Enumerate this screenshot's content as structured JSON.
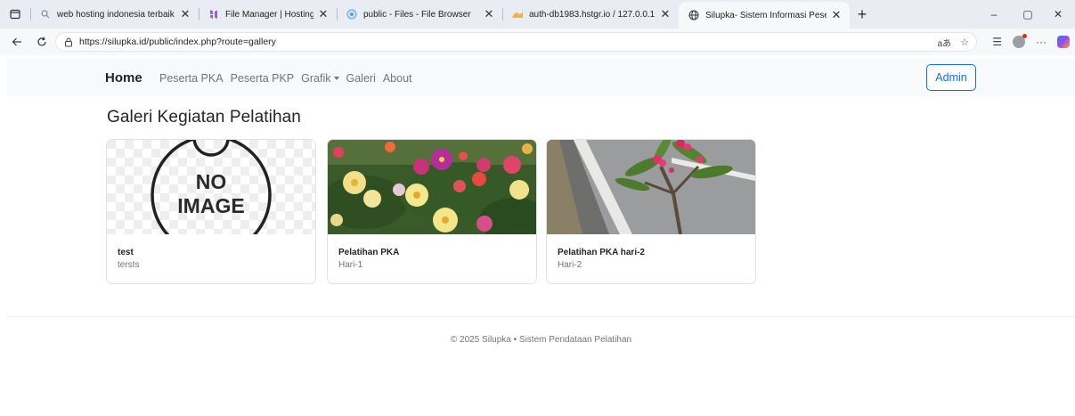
{
  "browser": {
    "tabs": [
      {
        "label": "web hosting indonesia terbaik - S",
        "icon": "search-icon",
        "active": false
      },
      {
        "label": "File Manager | Hostinger",
        "icon": "hostinger-icon",
        "active": false
      },
      {
        "label": "public - Files - File Browser",
        "icon": "filebrowser-icon",
        "active": false
      },
      {
        "label": "auth-db1983.hstgr.io / 127.0.0.1 /",
        "icon": "phpmyadmin-icon",
        "active": false
      },
      {
        "label": "Silupka- Sistem Informasi Peserta",
        "icon": "globe-icon",
        "active": true
      }
    ],
    "url": "https://silupka.id/public/index.php?route=gallery",
    "new_tab": "+",
    "window_controls": {
      "minimize": "–",
      "maximize": "▢",
      "close": "✕"
    }
  },
  "navbar": {
    "brand": "Home",
    "links": [
      {
        "label": "Peserta PKA",
        "dropdown": false
      },
      {
        "label": "Peserta PKP",
        "dropdown": false
      },
      {
        "label": "Grafik",
        "dropdown": true
      },
      {
        "label": "Galeri",
        "dropdown": false
      },
      {
        "label": "About",
        "dropdown": false
      }
    ],
    "admin_label": "Admin"
  },
  "page": {
    "title": "Galeri Kegiatan Pelatihan"
  },
  "gallery": [
    {
      "title": "test",
      "text": "tersts",
      "image": "no-image-placeholder",
      "image_text_1": "NO",
      "image_text_2": "IMAGE"
    },
    {
      "title": "Pelatihan PKA",
      "text": "Hari-1",
      "image": "flowers-photo"
    },
    {
      "title": "Pelatihan PKA hari-2",
      "text": "Hari-2",
      "image": "roadside-plant-photo"
    }
  ],
  "footer": {
    "text": "© 2025 Silupka • Sistem Pendataan Pelatihan"
  },
  "colors": {
    "primary": "#0d6efd",
    "muted": "#6c757d",
    "navbar_bg": "#f8f9fa",
    "tabstrip_bg": "#e9edf3"
  }
}
